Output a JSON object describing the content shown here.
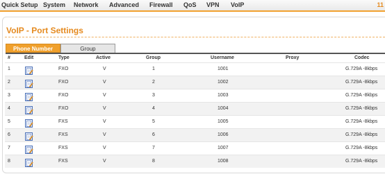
{
  "nav": {
    "items": [
      "Quick Setup",
      "System",
      "Network",
      "Advanced",
      "Firewall",
      "QoS",
      "VPN",
      "VoIP"
    ],
    "page_indicator": "11"
  },
  "page": {
    "title": "VoIP - Port Settings"
  },
  "tabs": {
    "phone_number": "Phone Number",
    "group": "Group"
  },
  "table": {
    "headers": {
      "num": "#",
      "edit": "Edit",
      "type": "Type",
      "active": "Active",
      "group": "Group",
      "username": "Username",
      "proxy": "Proxy",
      "codec": "Codec"
    },
    "rows": [
      {
        "num": "1",
        "type": "FXO",
        "active": "V",
        "group": "1",
        "username": "1001",
        "proxy": "",
        "codec": "G.729A -8kbps"
      },
      {
        "num": "2",
        "type": "FXO",
        "active": "V",
        "group": "2",
        "username": "1002",
        "proxy": "",
        "codec": "G.729A -8kbps"
      },
      {
        "num": "3",
        "type": "FXO",
        "active": "V",
        "group": "3",
        "username": "1003",
        "proxy": "",
        "codec": "G.729A -8kbps"
      },
      {
        "num": "4",
        "type": "FXO",
        "active": "V",
        "group": "4",
        "username": "1004",
        "proxy": "",
        "codec": "G.729A -8kbps"
      },
      {
        "num": "5",
        "type": "FXS",
        "active": "V",
        "group": "5",
        "username": "1005",
        "proxy": "",
        "codec": "G.729A -8kbps"
      },
      {
        "num": "6",
        "type": "FXS",
        "active": "V",
        "group": "6",
        "username": "1006",
        "proxy": "",
        "codec": "G.729A -8kbps"
      },
      {
        "num": "7",
        "type": "FXS",
        "active": "V",
        "group": "7",
        "username": "1007",
        "proxy": "",
        "codec": "G.729A -8kbps"
      },
      {
        "num": "8",
        "type": "FXS",
        "active": "V",
        "group": "8",
        "username": "1008",
        "proxy": "",
        "codec": "G.729A -8kbps"
      }
    ]
  },
  "icons": {
    "edit": "edit-icon"
  },
  "colors": {
    "accent": "#f0a02c",
    "title": "#e58a1f"
  }
}
